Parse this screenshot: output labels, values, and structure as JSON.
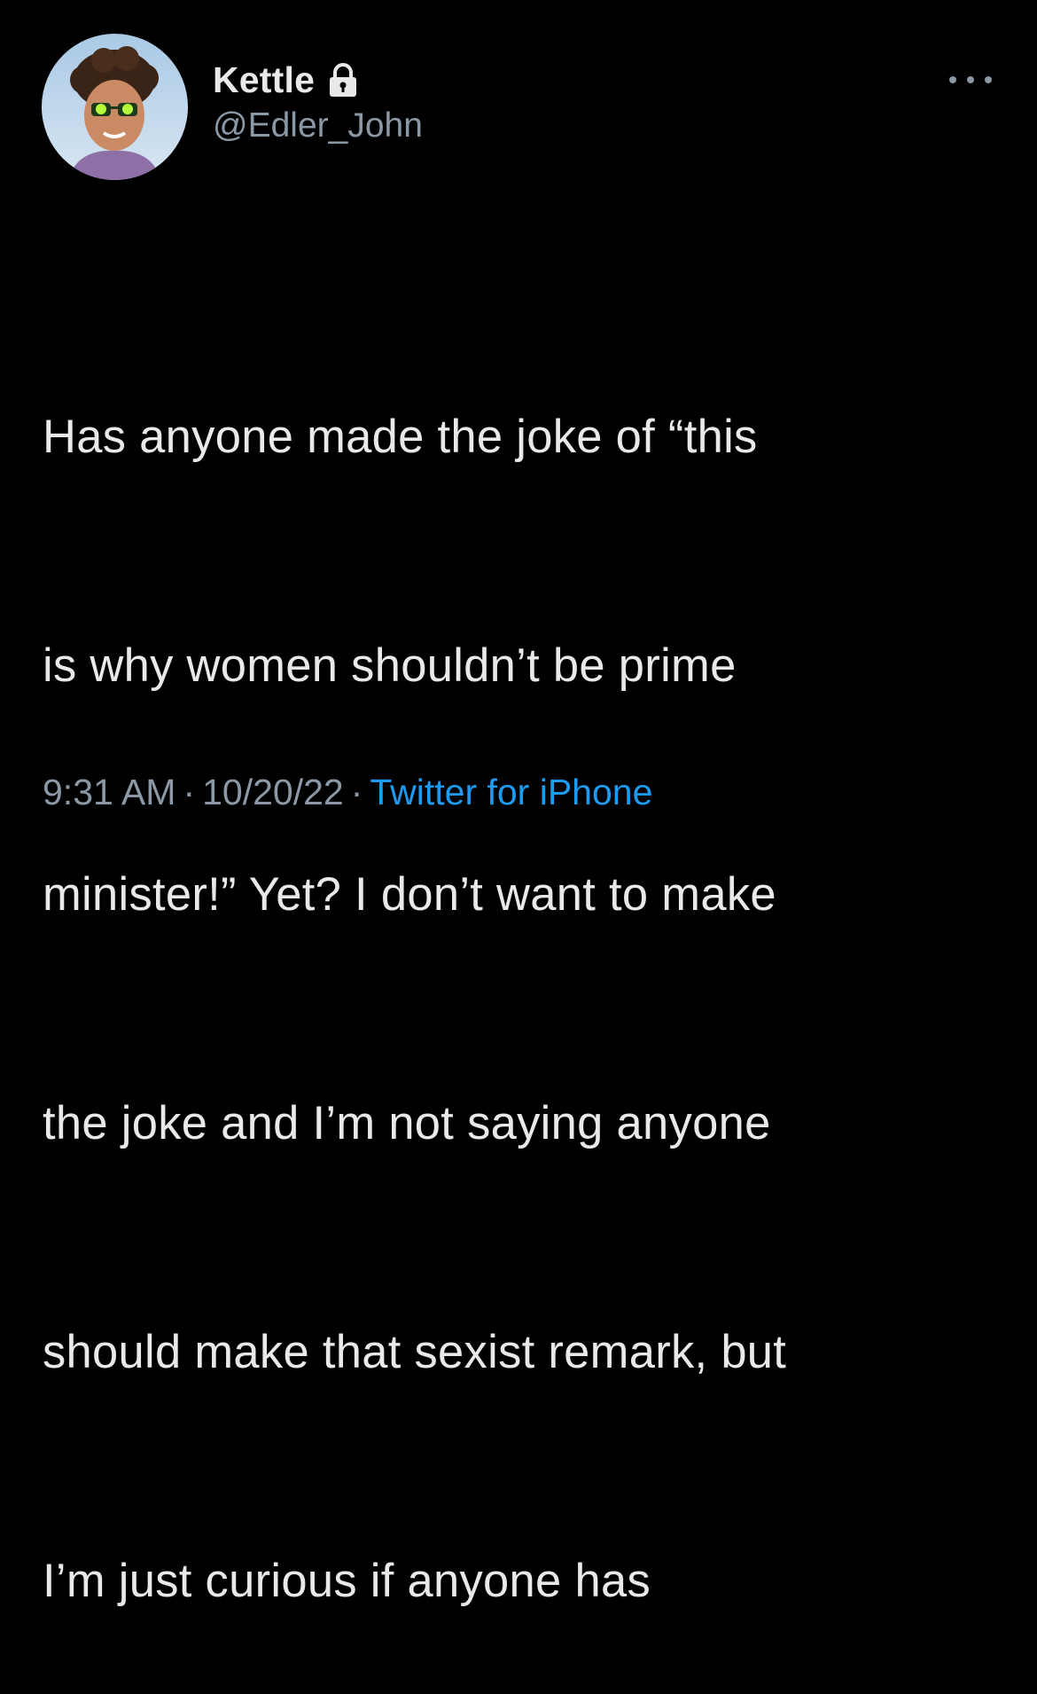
{
  "author": {
    "display_name": "Kettle",
    "handle": "@Edler_John",
    "protected_icon": "lock-icon",
    "avatar_icon": "profile-avatar"
  },
  "menu": {
    "icon": "more-dots-icon"
  },
  "tweet": {
    "lines": [
      "Has anyone made the joke of “this",
      "is why women shouldn’t be prime",
      "minister!” Yet? I don’t want to make",
      "the joke and I’m not saying anyone",
      "should make that sexist remark, but",
      "I’m just curious if anyone has"
    ]
  },
  "meta": {
    "time": "9:31 AM",
    "separator": "·",
    "date": "10/20/22",
    "source": "Twitter for iPhone"
  },
  "colors": {
    "background": "#000000",
    "text": "#e7e9ea",
    "secondary": "#8b98a5",
    "link": "#1d9bf0"
  }
}
